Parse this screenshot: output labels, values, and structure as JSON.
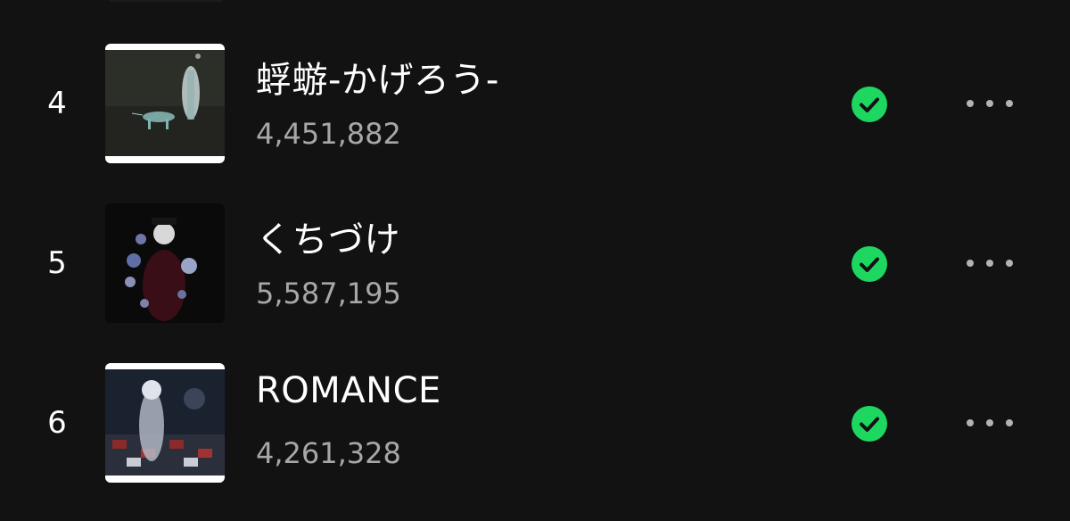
{
  "tracks": [
    {
      "index": "4",
      "title": "蜉蝣-かげろう-",
      "plays": "4,451,882"
    },
    {
      "index": "5",
      "title": "くちづけ",
      "plays": "5,587,195"
    },
    {
      "index": "6",
      "title": "ROMANCE",
      "plays": "4,261,328"
    }
  ],
  "colors": {
    "background": "#121212",
    "saved_check": "#1ed760",
    "secondary_text": "#a7a7a7"
  },
  "icons": {
    "saved": "check-circle-icon",
    "more": "more-horizontal-icon"
  }
}
